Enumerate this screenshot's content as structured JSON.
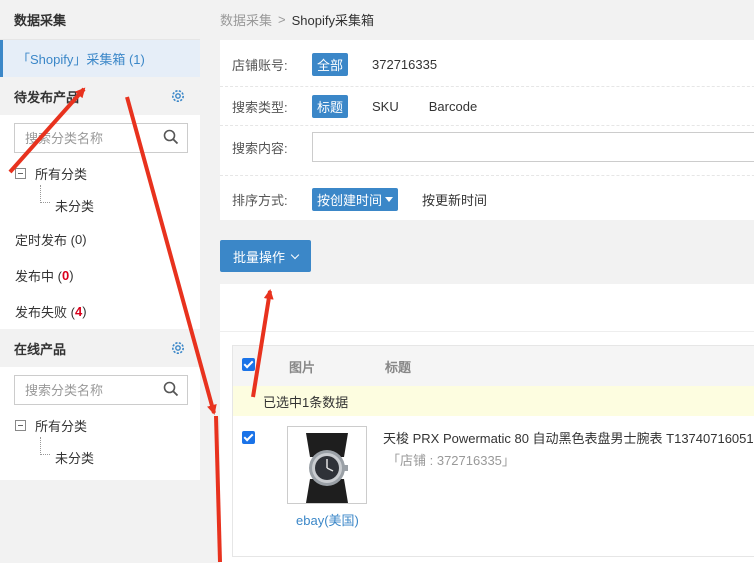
{
  "sidebar": {
    "title": "数据采集",
    "active_item": "「Shopify」采集箱 (1)",
    "pending": {
      "title": "待发布产品",
      "search_placeholder": "搜索分类名称",
      "tree_root": "所有分类",
      "tree_child": "未分类",
      "links": [
        {
          "label": "定时发布 (",
          "count": "0",
          "close": ")",
          "highlight": false
        },
        {
          "label": "发布中 (",
          "count": "0",
          "close": ")",
          "highlight": true
        },
        {
          "label": "发布失败 (",
          "count": "4",
          "close": ")",
          "highlight": true
        }
      ]
    },
    "online": {
      "title": "在线产品",
      "search_placeholder": "搜索分类名称",
      "tree_root": "所有分类",
      "tree_child": "未分类"
    }
  },
  "breadcrumb": {
    "parent": "数据采集",
    "separator": ">",
    "current": "Shopify采集箱"
  },
  "filters": {
    "store_label": "店铺账号:",
    "store_all": "全部",
    "store_account": "372716335",
    "search_type_label": "搜索类型:",
    "search_types": [
      "标题",
      "SKU",
      "Barcode"
    ],
    "search_content_label": "搜索内容:",
    "search_content_value": "",
    "sort_label": "排序方式:",
    "sort_active": "按创建时间",
    "sort_other": "按更新时间"
  },
  "bulk_button": "批量操作",
  "table": {
    "headers": [
      "图片",
      "标题"
    ],
    "selection_notice": "已选中1条数据",
    "rows": [
      {
        "title": "天梭 PRX Powermatic 80 自动黑色表盘男士腕表 T13740716051",
        "store": "「店铺 : 372716335」",
        "site": "ebay(美国)"
      }
    ]
  },
  "colors": {
    "accent": "#3b87c8",
    "annotation_arrow": "#e8321e",
    "selection_bg": "#fdfde0"
  }
}
